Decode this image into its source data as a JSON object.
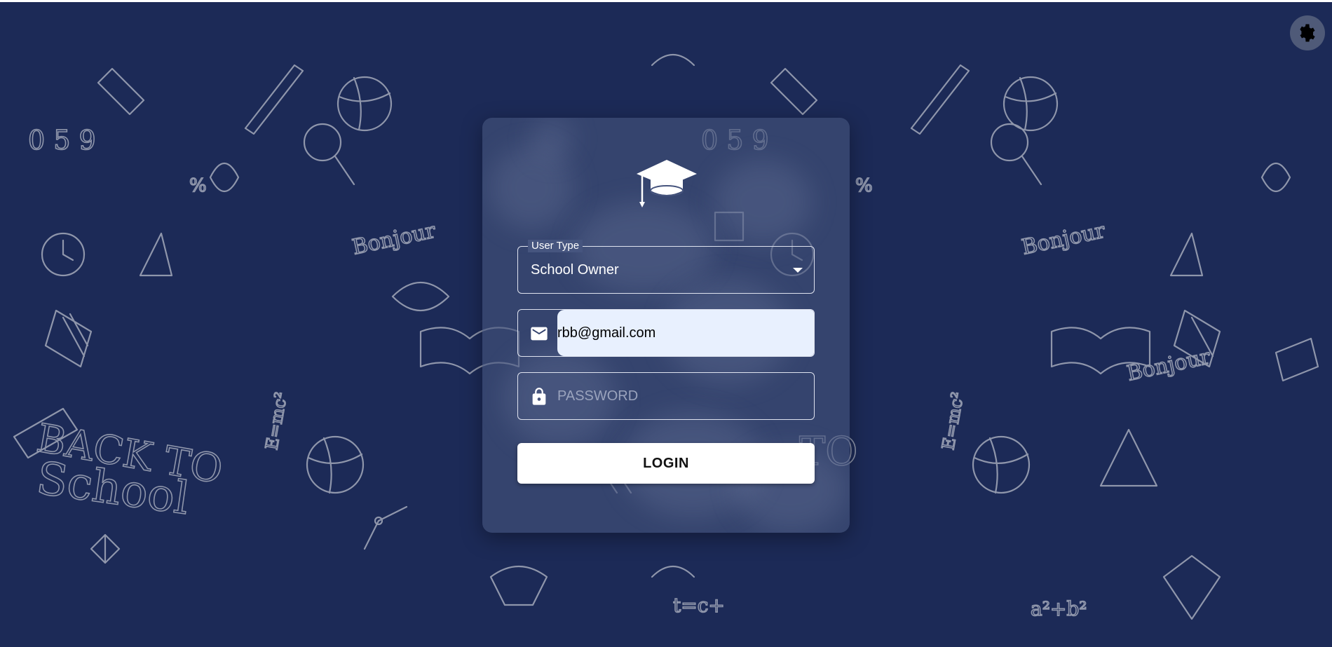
{
  "colors": {
    "background": "#1c2a57",
    "card": "#46547d",
    "autofill": "#e8f0fe",
    "button": "#ffffff"
  },
  "header": {
    "theme_toggle_icon": "gear-icon"
  },
  "background_art": {
    "text_back": "BACK TO",
    "text_school": "School",
    "text_bonjour": "Bonjour",
    "text_formula": "E=mc²"
  },
  "login_card": {
    "logo_icon": "graduation-cap-icon",
    "user_type": {
      "label": "User Type",
      "selected": "School Owner"
    },
    "email": {
      "icon": "mail-icon",
      "value": "rbb@gmail.com"
    },
    "password": {
      "icon": "lock-icon",
      "placeholder": "PASSWORD",
      "value": ""
    },
    "login_label": "LOGIN"
  }
}
